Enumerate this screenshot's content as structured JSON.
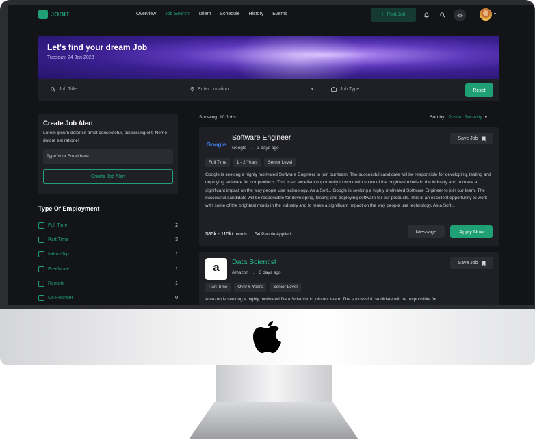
{
  "nav": {
    "brand": "JOBIT",
    "links": [
      "Overview",
      "Job Search",
      "Talent",
      "Schedule",
      "History",
      "Events"
    ],
    "active_link": "Job Search",
    "post_job": "Post Job"
  },
  "hero": {
    "title": "Let's find your dream Job",
    "date": "Tuesday, 24 Jan 2023"
  },
  "search": {
    "job_title_placeholder": "Job Title..",
    "location_placeholder": "Enter Location",
    "job_type_placeholder": "Job Type",
    "reset_label": "Reset"
  },
  "alert": {
    "title": "Create Job Alert",
    "description": "Lorem ipsum dolor sit amet consectetur, adipisicing elit. Nemo dolore est ratione!",
    "email_placeholder": "Type Your Email here",
    "button_label": "Create Job Alert"
  },
  "employment": {
    "title": "Type Of Employment",
    "items": [
      {
        "label": "Full Time",
        "count": "2"
      },
      {
        "label": "Part Time",
        "count": "3"
      },
      {
        "label": "Internship",
        "count": "1"
      },
      {
        "label": "Freelance",
        "count": "1"
      },
      {
        "label": "Remote",
        "count": "1"
      },
      {
        "label": "Co Founder",
        "count": "0"
      }
    ]
  },
  "results": {
    "showing": "Showing: 10 Jobs",
    "sort_label": "Sort by:",
    "sort_value": "Posted Recently"
  },
  "jobs": [
    {
      "title": "Software Engineer",
      "company": "Google",
      "posted": "3 days ago",
      "tags": [
        "Full Time",
        "1 - 2 Years",
        "Senior Level"
      ],
      "description": "Google is seeking a highly motivated Software Engineer to join our team. The successful candidate will be responsible for developing, testing and deploying software for our products. This is an excellent opportunity to work with some of the brightest minds in the industry and to make a significant impact on the way people use technology. As a Soft... Google is seeking a highly motivated Software Engineer to join our team. The successful candidate will be responsible for developing, testing and deploying software for our products. This is an excellent opportunity to work with some of the brightest minds in the industry and to make a significant impact on the way people use technology. As a Soft...",
      "salary": "$85k - 115k/",
      "salary_period": "month",
      "applied_count": "54",
      "applied_label": "People Applied",
      "save_label": "Save Job",
      "message_label": "Message",
      "apply_label": "Apply Now",
      "logo_text": "Google"
    },
    {
      "title": "Data Scientist",
      "company": "Amazon",
      "posted": "3 days ago",
      "tags": [
        "Part Time",
        "Over 6 Years",
        "Senior Level"
      ],
      "description": "Amazon is seeking a highly motivated Data Scientist to join our team. The successful candidate will be responsible for",
      "save_label": "Save Job",
      "logo_text": "a"
    }
  ],
  "colors": {
    "accent": "#1fa075",
    "background": "#131418",
    "card": "#1f2026"
  },
  "icons": [
    "logo-icon",
    "plus-icon",
    "bell-icon",
    "search-icon",
    "sun-icon",
    "chevron-down-icon",
    "location-pin-icon",
    "briefcase-icon",
    "bookmark-icon",
    "apple-logo-icon"
  ]
}
